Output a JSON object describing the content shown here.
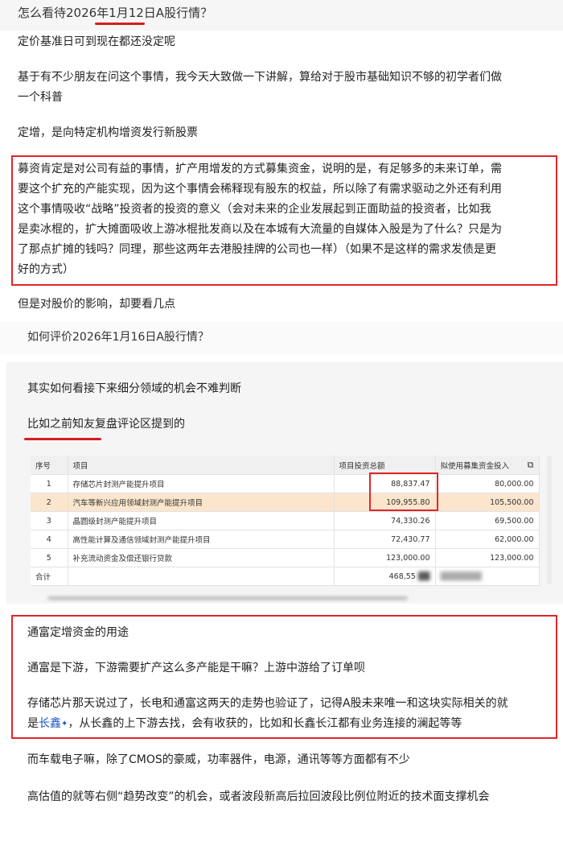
{
  "question1": {
    "text": "怎么看待2026年1月12日A股行情？"
  },
  "para_a": "定价基准日可到现在都还没定呢",
  "para_b": [
    "基于有不少朋友在问这个事情，我今天大致做一下讲解，算给对于股市基础知识不够的初学者们做",
    "一个科普"
  ],
  "para_c": "定增，是向特定机构增资发行新股票",
  "box1_lines": [
    "募资肯定是对公司有益的事情，扩产用增发的方式募集资金，说明的是，有足够多的未来订单，需",
    "要这个扩充的产能实现，因为这个事情会稀释现有股东的权益，所以除了有需求驱动之外还有利用",
    "这个事情吸收“战略”投资者的投资的意义（会对未来的企业发展起到正面助益的投资者，比如我",
    "是卖冰棍的，扩大摊面吸收上游冰棍批发商以及在本城有大流量的自媒体入股是为了什么？只是为",
    "了那点扩摊的钱吗？同理，那些这两年去港股挂牌的公司也一样）（如果不是这样的需求发债是更",
    "好的方式）"
  ],
  "para_d": "但是对股价的影响，却要看几点",
  "question2": {
    "text": "如何评价2026年1月16日A股行情？"
  },
  "para_e": "其实如何看接下来细分领域的机会不难判断",
  "para_f": "比如之前知友复盘评论区提到的",
  "table": {
    "headers": [
      "序号",
      "项目",
      "项目投资总额",
      "拟使用募集资金投入"
    ],
    "copy_icon": "copy-icon",
    "rows": [
      [
        "1",
        "存储芯片封测产能提升项目",
        "88,837.47",
        "80,000.00"
      ],
      [
        "2",
        "汽车等新兴应用领域封测产能提升项目",
        "109,955.80",
        "105,500.00"
      ],
      [
        "3",
        "晶圆级封测产能提升项目",
        "74,330.26",
        "69,500.00"
      ],
      [
        "4",
        "高性能计算及通信领域封测产能提升项目",
        "72,430.77",
        "62,000.00"
      ],
      [
        "5",
        "补充流动资金及偿还银行贷款",
        "123,000.00",
        "123,000.00"
      ]
    ],
    "total_label": "合计",
    "total_value": "468,55",
    "highlight_row": 2
  },
  "box2": {
    "title": "通富定增资金的用途",
    "line1": "通富是下游，下游需要扩产这么多产能是干嘛？上游中游给了订单呗",
    "line2": "存储芯片那天说过了，长电和通富这两天的走势也验证了，记得A股未来唯一和这块实际相关的就",
    "line3_pre": "是",
    "line3_link": "长鑫",
    "line3_post": "，从长鑫的上下游去找，会有收获的，比如和长鑫长江都有业务连接的澜起等等"
  },
  "para_g": "而车载电子嘛，除了CMOS的豪威，功率器件，电源，通讯等等方面都有不少",
  "para_h": "高估值的就等右侧“趋势改变”的机会，或者波段新高后拉回波段比例位附近的技术面支撑机会",
  "colors": {
    "highlight_red": "#e0262b",
    "row_highlight": "#fbe6cd",
    "link_blue": "#1a56c8"
  }
}
